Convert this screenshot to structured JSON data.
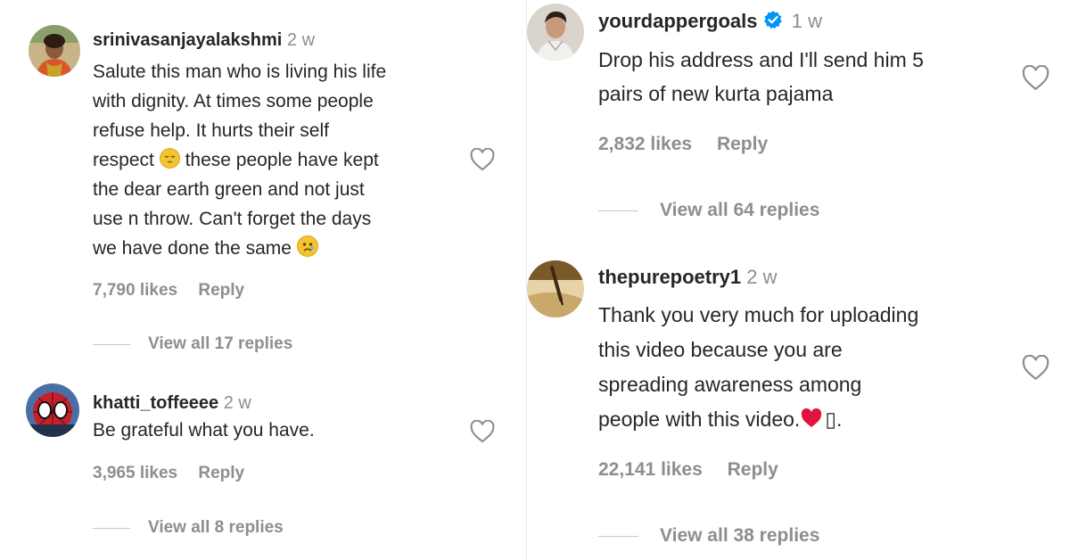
{
  "left_column": {
    "comments": [
      {
        "username": "srinivasanjayalakshmi",
        "time": "2 w",
        "text_lines": [
          "Salute this man who is living his life",
          "with dignity. At times some people",
          "refuse help. It hurts their self",
          "these people have kept",
          "the dear earth green and not just",
          "use n throw. Can't forget the days",
          "we have done the same"
        ],
        "text_line4_prefix": "respect",
        "likes": "7,790 likes",
        "reply": "Reply",
        "view_replies": "View all 17 replies"
      },
      {
        "username": "khatti_toffeeee",
        "time": "2 w",
        "text": "Be grateful what you have.",
        "likes": "3,965 likes",
        "reply": "Reply",
        "view_replies": "View all 8 replies"
      }
    ]
  },
  "right_column": {
    "comments": [
      {
        "username": "yourdappergoals",
        "verified": true,
        "time": "1 w",
        "text_lines": [
          "Drop his address and I'll send him 5",
          "pairs of new kurta pajama"
        ],
        "likes": "2,832 likes",
        "reply": "Reply",
        "view_replies": "View all 64 replies"
      },
      {
        "username": "thepurepoetry1",
        "time": "2 w",
        "text_lines": [
          "Thank you very much for uploading",
          "this video because you are",
          "spreading awareness among",
          "people with this video."
        ],
        "text_suffix": "▯.",
        "likes": "22,141 likes",
        "reply": "Reply",
        "view_replies": "View all 38 replies"
      }
    ]
  },
  "icons": {
    "like": "heart-outline-icon",
    "verified": "verified-badge-icon",
    "emoji_sad": "pensive-face-emoji",
    "emoji_cry": "sad-face-emoji",
    "emoji_heart": "red-heart-emoji"
  },
  "colors": {
    "text": "#262626",
    "muted": "#8e8e8e",
    "verified": "#0095f6",
    "heart_emoji": "#e0143c"
  }
}
